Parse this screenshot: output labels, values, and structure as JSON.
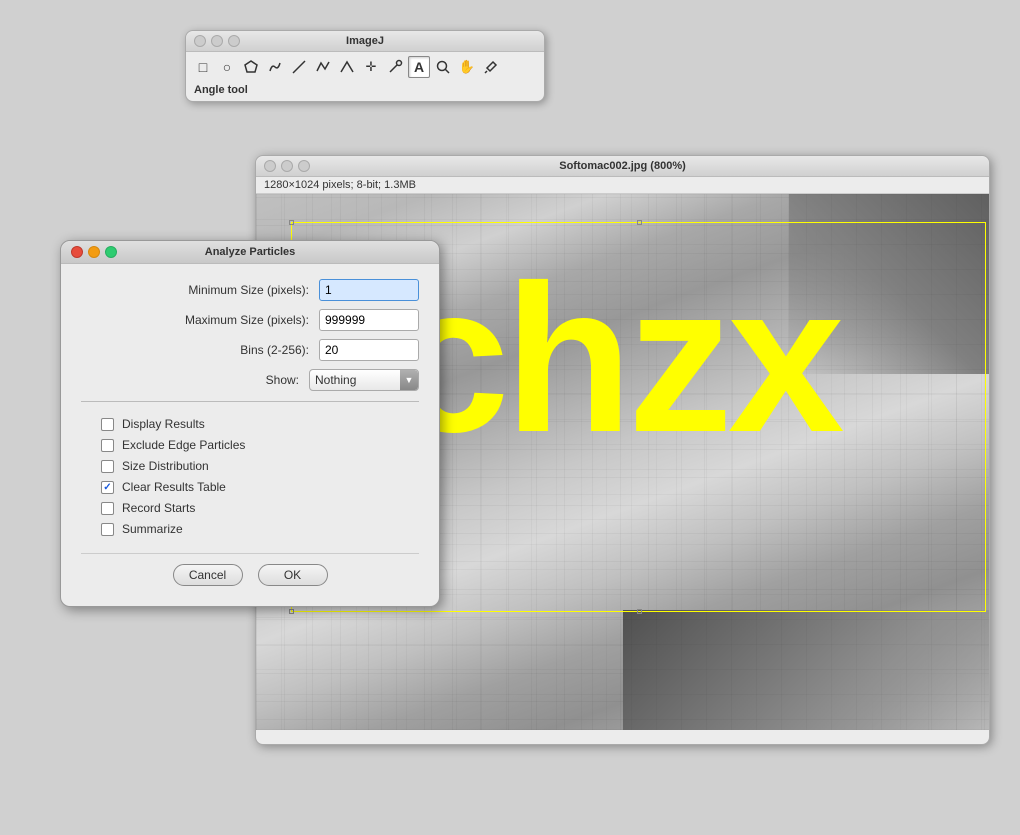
{
  "imagej_toolbar": {
    "title": "ImageJ",
    "status": "Angle tool",
    "icons": [
      {
        "name": "rectangle-tool-icon",
        "symbol": "□"
      },
      {
        "name": "oval-tool-icon",
        "symbol": "○"
      },
      {
        "name": "polygon-tool-icon",
        "symbol": "⬡"
      },
      {
        "name": "freehand-tool-icon",
        "symbol": "♡"
      },
      {
        "name": "line-tool-icon",
        "symbol": "╲"
      },
      {
        "name": "polyline-tool-icon",
        "symbol": "∽"
      },
      {
        "name": "angle-tool-icon",
        "symbol": "∧"
      },
      {
        "name": "point-tool-icon",
        "symbol": "✛"
      },
      {
        "name": "wand-tool-icon",
        "symbol": "⋰"
      },
      {
        "name": "text-tool-icon",
        "symbol": "A"
      },
      {
        "name": "magnify-tool-icon",
        "symbol": "🔍"
      },
      {
        "name": "hand-tool-icon",
        "symbol": "✋"
      },
      {
        "name": "eyedropper-tool-icon",
        "symbol": "✒"
      }
    ]
  },
  "image_window": {
    "title": "Softomac002.jpg (800%)",
    "info": "1280×1024 pixels; 8-bit; 1.3MB",
    "text_content": "j chzx"
  },
  "analyze_dialog": {
    "title": "Analyze Particles",
    "fields": {
      "min_size_label": "Minimum Size (pixels):",
      "min_size_value": "1",
      "max_size_label": "Maximum Size (pixels):",
      "max_size_value": "999999",
      "bins_label": "Bins (2-256):",
      "bins_value": "20",
      "show_label": "Show:",
      "show_value": "Nothing"
    },
    "checkboxes": [
      {
        "id": "display-results",
        "label": "Display Results",
        "checked": false
      },
      {
        "id": "exclude-edge",
        "label": "Exclude Edge Particles",
        "checked": false
      },
      {
        "id": "size-distribution",
        "label": "Size Distribution",
        "checked": false
      },
      {
        "id": "clear-results",
        "label": "Clear Results Table",
        "checked": true
      },
      {
        "id": "record-starts",
        "label": "Record Starts",
        "checked": false
      },
      {
        "id": "summarize",
        "label": "Summarize",
        "checked": false
      }
    ],
    "buttons": {
      "cancel": "Cancel",
      "ok": "OK"
    }
  }
}
